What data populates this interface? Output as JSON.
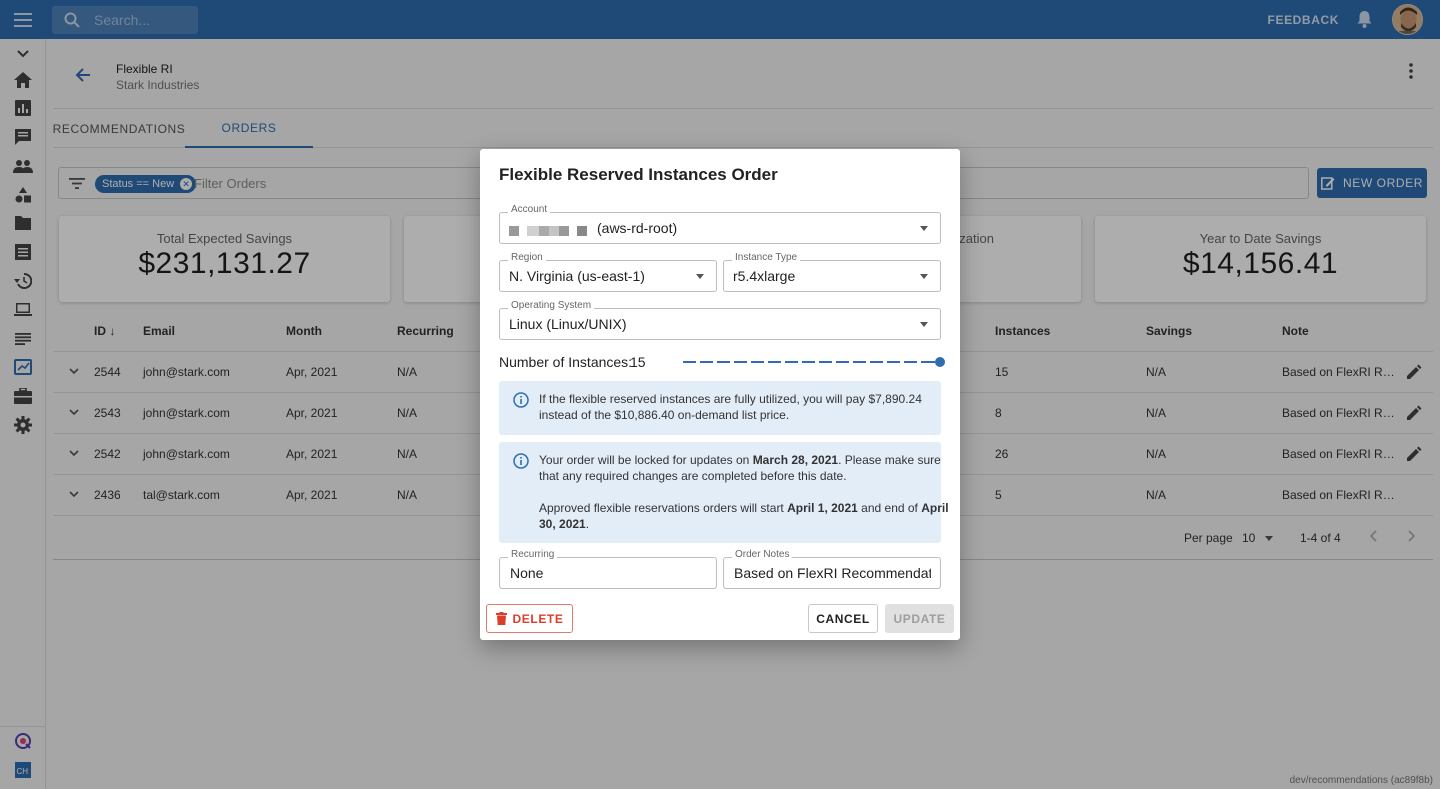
{
  "topbar": {
    "search_placeholder": "Search...",
    "feedback_label": "FEEDBACK"
  },
  "header": {
    "title": "Flexible RI",
    "subtitle": "Stark Industries"
  },
  "tabs": [
    {
      "label": "RECOMMENDATIONS",
      "active": false
    },
    {
      "label": "ORDERS",
      "active": true
    }
  ],
  "filter": {
    "chip_label": "Status == New",
    "placeholder": "Filter Orders",
    "new_order_label": "NEW ORDER"
  },
  "cards": {
    "total_label": "Total Expected Savings",
    "total_value": "$231,131.27",
    "partial_label": "ization",
    "ytd_label": "Year to Date Savings",
    "ytd_value": "$14,156.41"
  },
  "table": {
    "headers": {
      "id": "ID",
      "email": "Email",
      "month": "Month",
      "recurring": "Recurring",
      "instances": "Instances",
      "savings": "Savings",
      "note": "Note"
    },
    "rows": [
      {
        "id": "2544",
        "email": "john@stark.com",
        "month": "Apr, 2021",
        "recurring": "N/A",
        "instances": "15",
        "savings": "N/A",
        "note": "Based on FlexRI R…"
      },
      {
        "id": "2543",
        "email": "john@stark.com",
        "month": "Apr, 2021",
        "recurring": "N/A",
        "instances": "8",
        "savings": "N/A",
        "note": "Based on FlexRI R…"
      },
      {
        "id": "2542",
        "email": "john@stark.com",
        "month": "Apr, 2021",
        "recurring": "N/A",
        "instances": "26",
        "savings": "N/A",
        "note": "Based on FlexRI R…"
      },
      {
        "id": "2436",
        "email": "tal@stark.com",
        "month": "Apr, 2021",
        "recurring": "N/A",
        "instances": "5",
        "savings": "N/A",
        "note": "Based on FlexRI R…"
      }
    ],
    "per_page_label": "Per page",
    "per_page_value": "10",
    "range_label": "1-4 of 4"
  },
  "footer_note": "dev/recommendations (ac89f8b)",
  "dialog": {
    "title": "Flexible Reserved Instances Order",
    "account_label": "Account",
    "account_value": "(aws-rd-root)",
    "region_label": "Region",
    "region_value": "N. Virginia (us-east-1)",
    "instance_type_label": "Instance Type",
    "instance_type_value": "r5.4xlarge",
    "os_label": "Operating System",
    "os_value": "Linux (Linux/UNIX)",
    "num_instances_label": "Number of Instances:",
    "num_instances_value": "15",
    "num_instances_fraction": 1.0,
    "info1_line1": "If the flexible reserved instances are fully utilized, you will pay $7,890.24",
    "info1_line2": "instead of the $10,886.40 on-demand list price.",
    "info2_a": "Your order will be locked for updates on ",
    "info2_lock_date": "March 28, 2021",
    "info2_b": ". Please make sure",
    "info2_line2": "that any required changes are completed before this date.",
    "info2_c": "Approved flexible reservations orders will start ",
    "info2_start": "April 1, 2021",
    "info2_d": " and end of ",
    "info2_end1": "April",
    "info2_end2": "30, 2021",
    "info2_e": ".",
    "recurring_label": "Recurring",
    "recurring_value": "None",
    "notes_label": "Order Notes",
    "notes_value": "Based on FlexRI Recommendations",
    "delete_label": "DELETE",
    "cancel_label": "CANCEL",
    "update_label": "UPDATE"
  },
  "colors": {
    "primary": "#2f6db1",
    "danger": "#d9402b",
    "info_bg": "#e3edf8"
  }
}
